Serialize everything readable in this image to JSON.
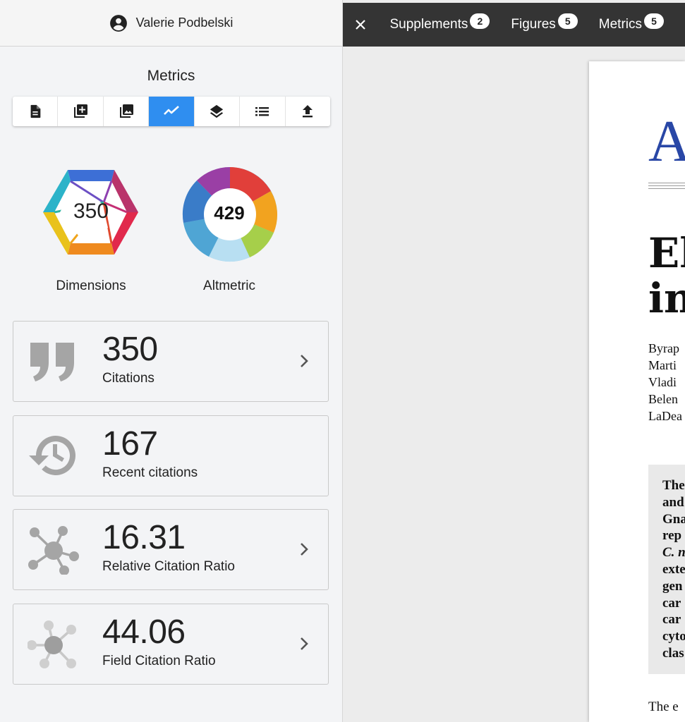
{
  "user": {
    "name": "Valerie Podbelski",
    "icon": "account-circle-icon"
  },
  "panel": {
    "title": "Metrics"
  },
  "toolbar": {
    "items": [
      {
        "icon": "document-icon",
        "active": false
      },
      {
        "icon": "add-supplement-icon",
        "active": false
      },
      {
        "icon": "image-icon",
        "active": false
      },
      {
        "icon": "trending-icon",
        "active": true
      },
      {
        "icon": "layers-icon",
        "active": false
      },
      {
        "icon": "list-icon",
        "active": false
      },
      {
        "icon": "upload-icon",
        "active": false
      }
    ],
    "active_color": "#2f8ef0"
  },
  "badges": {
    "dimensions": {
      "value": "350",
      "label": "Dimensions"
    },
    "altmetric": {
      "value": "429",
      "label": "Altmetric"
    }
  },
  "cards": [
    {
      "value": "350",
      "label": "Citations",
      "icon": "quote-icon",
      "has_chevron": true
    },
    {
      "value": "167",
      "label": "Recent citations",
      "icon": "history-icon",
      "has_chevron": false
    },
    {
      "value": "16.31",
      "label": "Relative Citation Ratio",
      "icon": "network-icon",
      "has_chevron": true
    },
    {
      "value": "44.06",
      "label": "Field Citation Ratio",
      "icon": "network-light-icon",
      "has_chevron": true
    }
  ],
  "topbar": {
    "close_icon": "close-icon",
    "tabs": [
      {
        "label": "Supplements",
        "count": "2"
      },
      {
        "label": "Figures",
        "count": "5"
      },
      {
        "label": "Metrics",
        "count": "5"
      }
    ]
  },
  "document": {
    "journal_fragment": "A",
    "title_lines": [
      "El",
      "in"
    ],
    "author_lines": [
      "Byrap",
      "Marti",
      "Vladi",
      "Belen",
      "LaDea"
    ],
    "abstract_lines": [
      "The",
      "and",
      "Gna",
      "rep",
      "C. n",
      "exte",
      "gen",
      "car",
      "car",
      "cyto",
      "clas"
    ],
    "body_start": "The e"
  },
  "colors": {
    "topbar_bg": "#343434",
    "sidebar_bg": "#f3f4f6",
    "journal_blue": "#2947a6",
    "icon_gray": "#9e9e9e"
  }
}
